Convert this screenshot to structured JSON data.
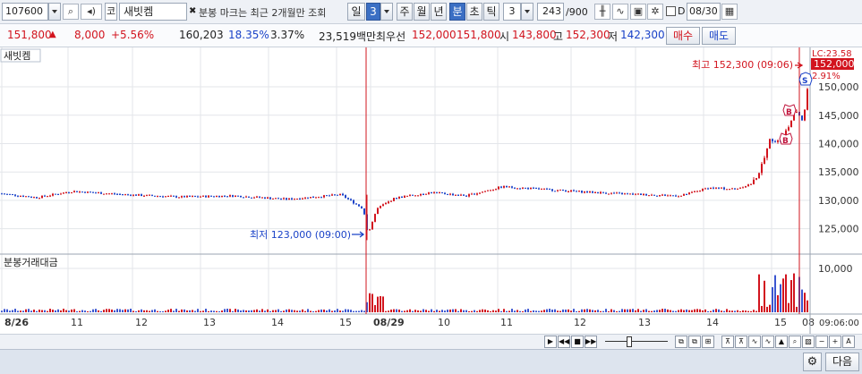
{
  "toolbar": {
    "code": "107600",
    "market_badge": "코",
    "stock_name": "새빗켐",
    "note": "분봉 마크는 최근 2개월만 조회",
    "periods": [
      "일",
      "3",
      "주",
      "월",
      "년",
      "분",
      "초",
      "틱"
    ],
    "interval_value": "3",
    "count": "243",
    "count_total": "/900",
    "date_flag": "D",
    "date": "08/30"
  },
  "quote": {
    "price": "151,800",
    "change": "8,000",
    "change_pct": "+5.56%",
    "volume": "160,203",
    "turnover_ratio": "18.35%",
    "other_pct": "3.37%",
    "amount": "23,519백만",
    "bid_ask_label": "최우선",
    "bid_ask_1": "152,000",
    "bid_ask_2": "151,800",
    "open_label": "시",
    "open": "143,800",
    "high_label": "고",
    "high": "152,300",
    "low_label": "저",
    "low": "142,300",
    "buy_label": "매수",
    "sell_label": "매도"
  },
  "chart_data": {
    "type": "candlestick",
    "title": "새빗켐",
    "volume_title": "분봉거래대금",
    "y_ticks": [
      "150,000",
      "145,000",
      "140,000",
      "135,000",
      "130,000",
      "125,000"
    ],
    "ylim": [
      121000,
      156000
    ],
    "volume_ticks": [
      "10,000"
    ],
    "x_labels": [
      "8/26",
      "11",
      "12",
      "13",
      "14",
      "15",
      "08/29",
      "10",
      "11",
      "12",
      "13",
      "14",
      "15",
      "08",
      "09:06:00"
    ],
    "current_price_label": "152,000",
    "lc_label": "LC:23.58",
    "pct_label": "2.91%",
    "high_annotation": "최고 152,300 (09:06)",
    "low_annotation": "최저 123,000 (09:00)",
    "markers": [
      "B",
      "B",
      "S"
    ],
    "price_path": [
      [
        0,
        131200
      ],
      [
        40,
        130500
      ],
      [
        80,
        131600
      ],
      [
        140,
        131000
      ],
      [
        200,
        130600
      ],
      [
        260,
        130800
      ],
      [
        320,
        130200
      ],
      [
        380,
        131000
      ],
      [
        405,
        128500
      ],
      [
        410,
        124000
      ],
      [
        420,
        128500
      ],
      [
        440,
        130400
      ],
      [
        480,
        131400
      ],
      [
        520,
        130800
      ],
      [
        560,
        132400
      ],
      [
        600,
        132000
      ],
      [
        640,
        131600
      ],
      [
        700,
        131100
      ],
      [
        760,
        130800
      ],
      [
        790,
        132200
      ],
      [
        820,
        132000
      ],
      [
        840,
        133000
      ],
      [
        850,
        136000
      ],
      [
        860,
        141000
      ],
      [
        870,
        140200
      ],
      [
        880,
        143000
      ],
      [
        888,
        146000
      ],
      [
        896,
        144000
      ],
      [
        902,
        150500
      ]
    ]
  },
  "bottom": {
    "next_label": "다음"
  }
}
